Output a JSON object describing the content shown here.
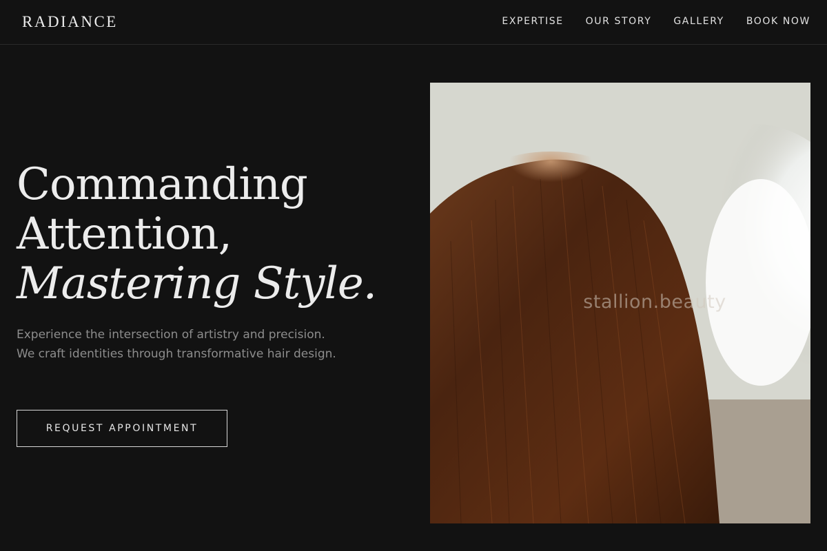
{
  "header": {
    "brand": "RADIANCE",
    "nav": [
      "EXPERTISE",
      "OUR STORY",
      "GALLERY",
      "BOOK NOW"
    ]
  },
  "hero": {
    "title_line1": "Commanding",
    "title_line2": "Attention,",
    "title_line3": "Mastering Style.",
    "subtitle": "Experience the intersection of artistry and precision. We craft identities through transformative hair design.",
    "cta": "REQUEST APPOINTMENT",
    "image_watermark": "stallion.beauty"
  },
  "colors": {
    "background": "#121212",
    "text_primary": "#ececec",
    "text_muted": "#8d8d8d",
    "hair": "#5a2e14"
  }
}
